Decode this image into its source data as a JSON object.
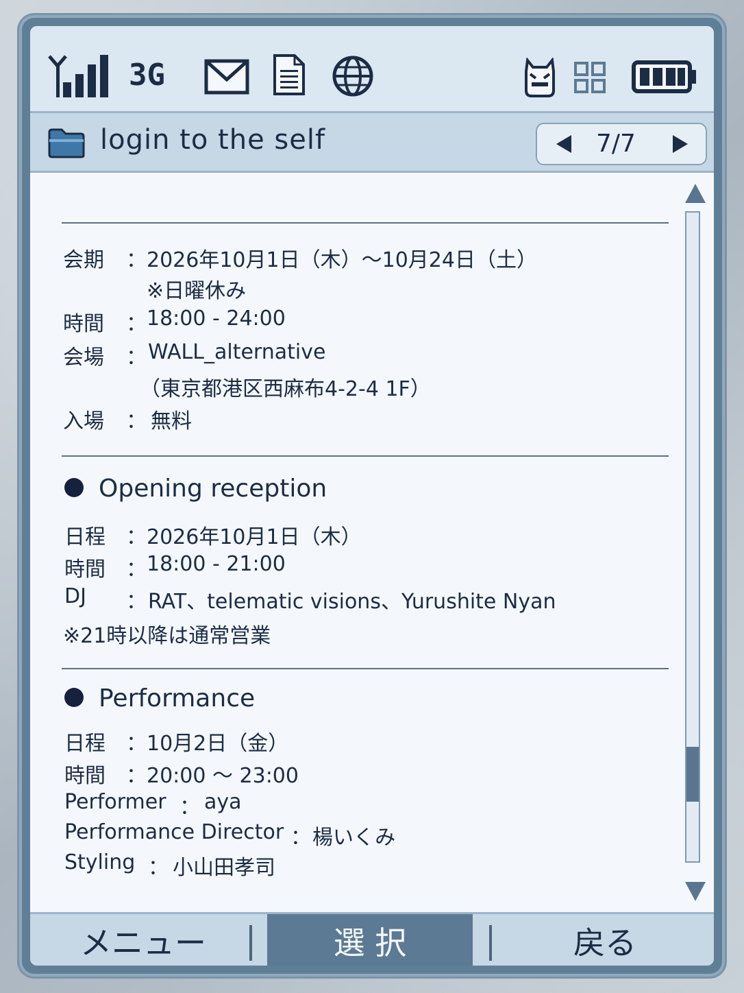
{
  "status": {
    "network": "3G",
    "icons": [
      "signal-icon",
      "envelope-icon",
      "document-icon",
      "globe-icon",
      "mascot-icon",
      "grid-icon",
      "battery-icon"
    ]
  },
  "header": {
    "title": "login to the self",
    "pager": "7/7"
  },
  "exhibition": {
    "period_key": "会期",
    "period_value": "2026年10月1日（木）～10月24日（土）",
    "period_note": "※日曜休み",
    "time_key": "時間",
    "time_value": "18:00 - 24:00",
    "venue_key": "会場",
    "venue_value": "WALL_alternative",
    "venue_address": "（東京都港区西麻布4-2-4 1F）",
    "entry_key": "入場",
    "entry_value": "無料"
  },
  "opening": {
    "heading": "Opening reception",
    "date_key": "日程",
    "date_value": "2026年10月1日（木）",
    "time_key": "時間",
    "time_value": "18:00 - 21:00",
    "dj_key": "DJ",
    "dj_value": "RAT、telematic visions、Yurushite Nyan",
    "note": "※21時以降は通常営業"
  },
  "performance": {
    "heading": "Performance",
    "date_key": "日程",
    "date_value": "10月2日（金）",
    "time_key": "時間",
    "time_value": "20:00 ～ 23:00",
    "performer_key": "Performer",
    "performer_value": "aya",
    "director_key": "Performance Director",
    "director_value": "楊いくみ",
    "styling_key": "Styling",
    "styling_value": "小山田孝司"
  },
  "separator": "：",
  "scroll_position": 0.9,
  "softkeys": {
    "menu": "メニュー",
    "select": "選 択",
    "back": "戻る"
  },
  "colors": {
    "text": "#1c2c45",
    "accent": "#5c7a94",
    "bar": "#c6d7e5"
  }
}
